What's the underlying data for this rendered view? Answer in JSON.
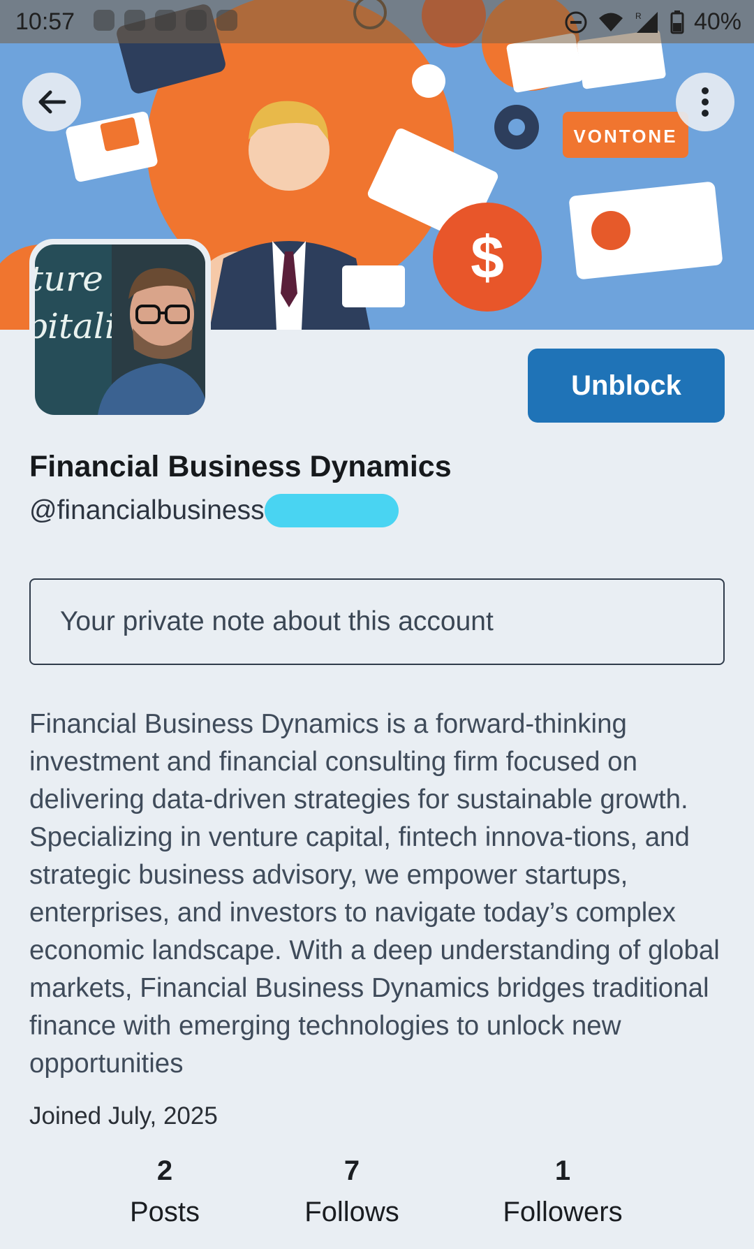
{
  "status_bar": {
    "time": "10:57",
    "battery": "40%",
    "signal_label": "R"
  },
  "banner": {
    "sign_text": "VONTONE",
    "currency_symbol": "$"
  },
  "avatar": {
    "chalk_text_top": "ture",
    "chalk_text_bottom": "pitalist"
  },
  "actions": {
    "unblock_label": "Unblock"
  },
  "profile": {
    "display_name": "Financial Business Dynamics",
    "handle": "@financialbusiness",
    "note_placeholder": "Your private note about this account",
    "bio": "Financial Business Dynamics is a forward-thinking investment and financial consulting firm focused on delivering data-driven strategies for sustainable growth. Specializing in venture capital, fintech innova-tions, and strategic business advisory, we empower startups, enterprises, and investors to navigate today’s complex economic landscape. With a deep understanding of global markets, Financial Business Dynamics bridges traditional finance with emerging technologies to unlock new opportunities",
    "joined": "Joined July, 2025"
  },
  "stats": {
    "posts_count": "2",
    "posts_label": "Posts",
    "follows_count": "7",
    "follows_label": "Follows",
    "followers_count": "1",
    "followers_label": "Followers"
  },
  "colors": {
    "accent": "#1f73b7",
    "background": "#e9eef3",
    "banner_blue": "#6ea3dc",
    "banner_orange": "#f0752f",
    "redaction": "#49d4f2"
  }
}
